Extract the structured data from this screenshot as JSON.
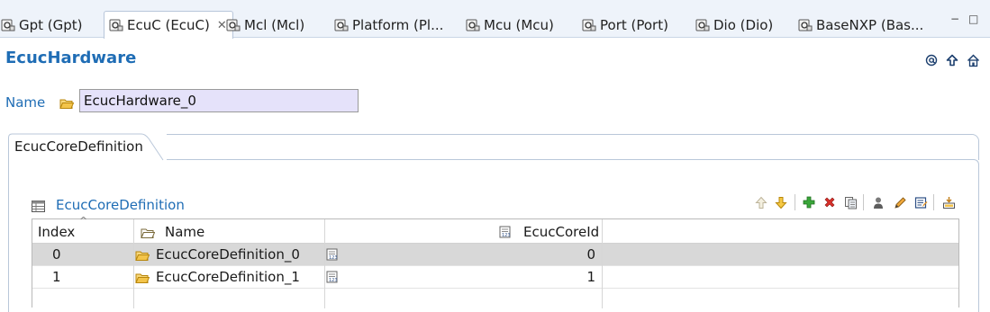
{
  "tabs": [
    {
      "label": "Gpt (Gpt)",
      "active": false
    },
    {
      "label": "EcuC (EcuC)",
      "active": true
    },
    {
      "label": "Mcl (Mcl)",
      "active": false
    },
    {
      "label": "Platform (Pl...",
      "active": false
    },
    {
      "label": "Mcu (Mcu)",
      "active": false
    },
    {
      "label": "Port (Port)",
      "active": false
    },
    {
      "label": "Dio (Dio)",
      "active": false
    },
    {
      "label": "BaseNXP (Bas...",
      "active": false
    }
  ],
  "tab_close_glyph": "✕",
  "window_controls": {
    "minimize": "−",
    "maximize": "□"
  },
  "form": {
    "title": "EcucHardware",
    "header_buttons": [
      "at-icon",
      "up-arrow-icon",
      "home-icon"
    ],
    "name_label": "Name",
    "name_value": "EcucHardware_0"
  },
  "section": {
    "tab_label": "EcucCoreDefinition"
  },
  "table": {
    "title": "EcucCoreDefinition",
    "toolbar": [
      "move-up-icon",
      "move-down-icon",
      "add-icon",
      "delete-icon",
      "copy-icon",
      "user-icon",
      "edit-icon",
      "properties-icon",
      "export-icon"
    ],
    "columns": [
      "Index",
      "Name",
      "EcucCoreId"
    ],
    "sort_indicator": "^",
    "rows": [
      {
        "index": "0",
        "name": "EcucCoreDefinition_0",
        "core_id": "0",
        "selected": true
      },
      {
        "index": "1",
        "name": "EcucCoreDefinition_1",
        "core_id": "1",
        "selected": false
      }
    ]
  },
  "colors": {
    "accent": "#1f6db5",
    "tabbar_bg": "#eef3fa",
    "name_field_bg": "#e5e2fa",
    "selected_row": "#d8d8d8"
  }
}
